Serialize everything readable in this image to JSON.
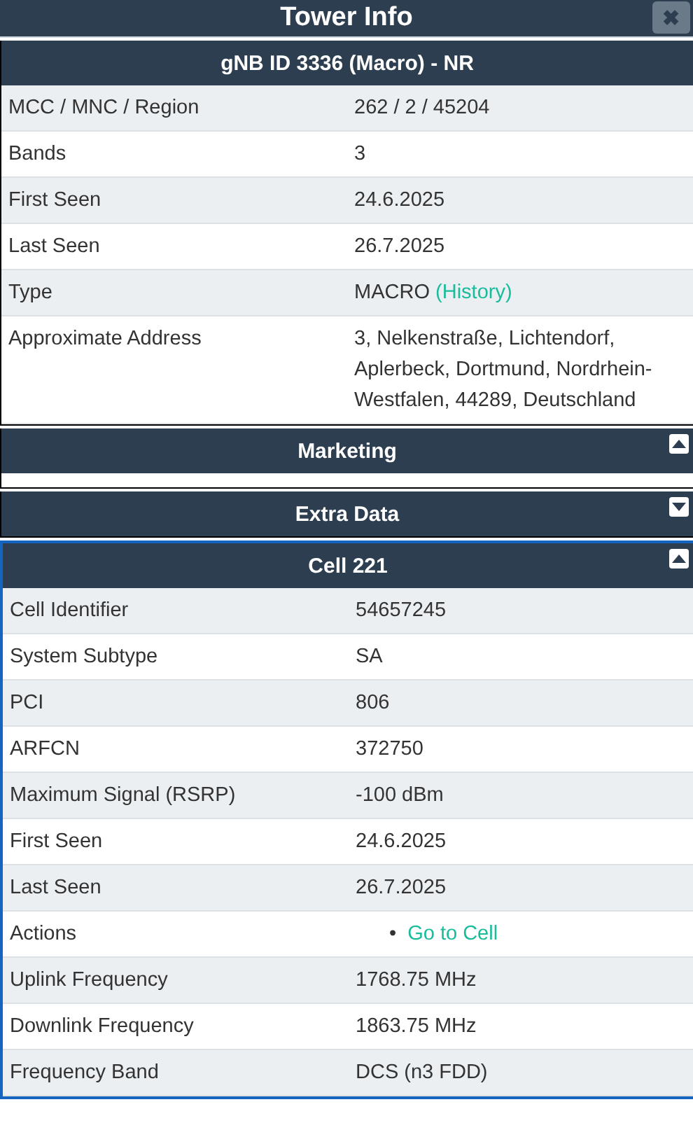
{
  "window": {
    "title": "Tower Info",
    "close": "✖"
  },
  "sections": [
    {
      "title": "gNB ID 3336 (Macro) - NR",
      "kind": "fixed",
      "highlighted": false,
      "rows": [
        {
          "kind": "text",
          "label": "MCC / MNC / Region",
          "value": "262 / 2 / 45204"
        },
        {
          "kind": "text",
          "label": "Bands",
          "value": "3"
        },
        {
          "kind": "text",
          "label": "First Seen",
          "value": "24.6.2025"
        },
        {
          "kind": "text",
          "label": "Last Seen",
          "value": "26.7.2025"
        },
        {
          "kind": "text_link",
          "label": "Type",
          "value": "MACRO",
          "link": "(History)"
        },
        {
          "kind": "text",
          "label": "Approximate Address",
          "value": "3, Nelkenstraße, Lichtendorf, Aplerbeck, Dortmund, Nordrhein-Westfalen, 44289, Deutschland"
        }
      ]
    },
    {
      "title": "Marketing",
      "kind": "collapsible",
      "expanded": true,
      "highlighted": false
    },
    {
      "title": "Extra Data",
      "kind": "collapsible",
      "expanded": false,
      "highlighted": false
    },
    {
      "title": "Cell 221",
      "kind": "collapsible",
      "expanded": true,
      "highlighted": true,
      "rows": [
        {
          "kind": "text",
          "label": "Cell Identifier",
          "value": "54657245"
        },
        {
          "kind": "text",
          "label": "System Subtype",
          "value": "SA"
        },
        {
          "kind": "text",
          "label": "PCI",
          "value": "806"
        },
        {
          "kind": "text",
          "label": "ARFCN",
          "value": "372750"
        },
        {
          "kind": "text",
          "label": "Maximum Signal (RSRP)",
          "value": "-100 dBm"
        },
        {
          "kind": "text",
          "label": "First Seen",
          "value": "24.6.2025"
        },
        {
          "kind": "text",
          "label": "Last Seen",
          "value": "26.7.2025"
        },
        {
          "kind": "link_list",
          "label": "Actions",
          "links": [
            {
              "bullet": "•",
              "label": "Go to Cell"
            }
          ]
        },
        {
          "kind": "text",
          "label": "Uplink Frequency",
          "value": "1768.75 MHz"
        },
        {
          "kind": "text",
          "label": "Downlink Frequency",
          "value": "1863.75 MHz"
        },
        {
          "kind": "text",
          "label": "Frequency Band",
          "value": "DCS (n3 FDD)"
        }
      ]
    }
  ]
}
